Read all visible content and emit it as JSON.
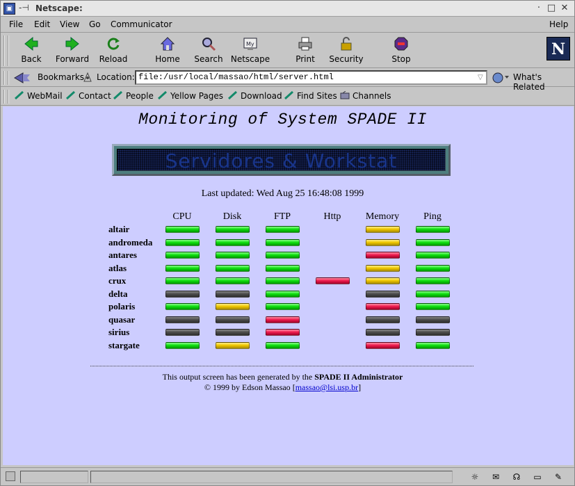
{
  "window": {
    "title": "Netscape:"
  },
  "menu": [
    "File",
    "Edit",
    "View",
    "Go",
    "Communicator",
    "Help"
  ],
  "toolbar": {
    "buttons": [
      "Back",
      "Forward",
      "Reload",
      "Home",
      "Search",
      "Netscape",
      "Print",
      "Security",
      "Stop"
    ],
    "logo": "N"
  },
  "location": {
    "bookmarks_label": "Bookmarks",
    "location_label": "Location:",
    "url": "file:/usr/local/massao/html/server.html",
    "related_label": "What's Related"
  },
  "personal_toolbar": [
    "WebMail",
    "Contact",
    "People",
    "Yellow Pages",
    "Download",
    "Find Sites",
    "Channels"
  ],
  "page": {
    "title": "Monitoring of System SPADE II",
    "banner_text": "Servidores & Workstat",
    "last_updated": "Last updated: Wed Aug 25 16:48:08 1999",
    "columns": [
      "CPU",
      "Disk",
      "FTP",
      "Http",
      "Memory",
      "Ping"
    ],
    "hosts": [
      {
        "name": "altair",
        "status": [
          "green",
          "green",
          "green",
          "none",
          "yellow",
          "green"
        ]
      },
      {
        "name": "andromeda",
        "status": [
          "green",
          "green",
          "green",
          "none",
          "yellow",
          "green"
        ]
      },
      {
        "name": "antares",
        "status": [
          "green",
          "green",
          "green",
          "none",
          "red",
          "green"
        ]
      },
      {
        "name": "atlas",
        "status": [
          "green",
          "green",
          "green",
          "none",
          "yellow",
          "green"
        ]
      },
      {
        "name": "crux",
        "status": [
          "green",
          "green",
          "green",
          "red",
          "yellow",
          "green"
        ]
      },
      {
        "name": "delta",
        "status": [
          "gray",
          "gray",
          "green",
          "none",
          "gray",
          "green"
        ]
      },
      {
        "name": "polaris",
        "status": [
          "green",
          "yellow",
          "green",
          "none",
          "red",
          "green"
        ]
      },
      {
        "name": "quasar",
        "status": [
          "gray",
          "gray",
          "red",
          "none",
          "gray",
          "gray"
        ]
      },
      {
        "name": "sirius",
        "status": [
          "gray",
          "gray",
          "red",
          "none",
          "gray",
          "gray"
        ]
      },
      {
        "name": "stargate",
        "status": [
          "green",
          "yellow",
          "green",
          "none",
          "red",
          "green"
        ]
      }
    ],
    "footer_text": "This output screen has been generated by the",
    "footer_bold": "SPADE II Administrator",
    "copyright": "© 1999 by Edson Massao",
    "email": "massao@lsi.usp.br"
  },
  "colors": {
    "page_bg": "#cdcdff",
    "chrome_bg": "#c6c6c6",
    "ok": "#10e010",
    "warn": "#f0c800",
    "fail": "#f01d4f",
    "off": "#4d4d4d"
  }
}
